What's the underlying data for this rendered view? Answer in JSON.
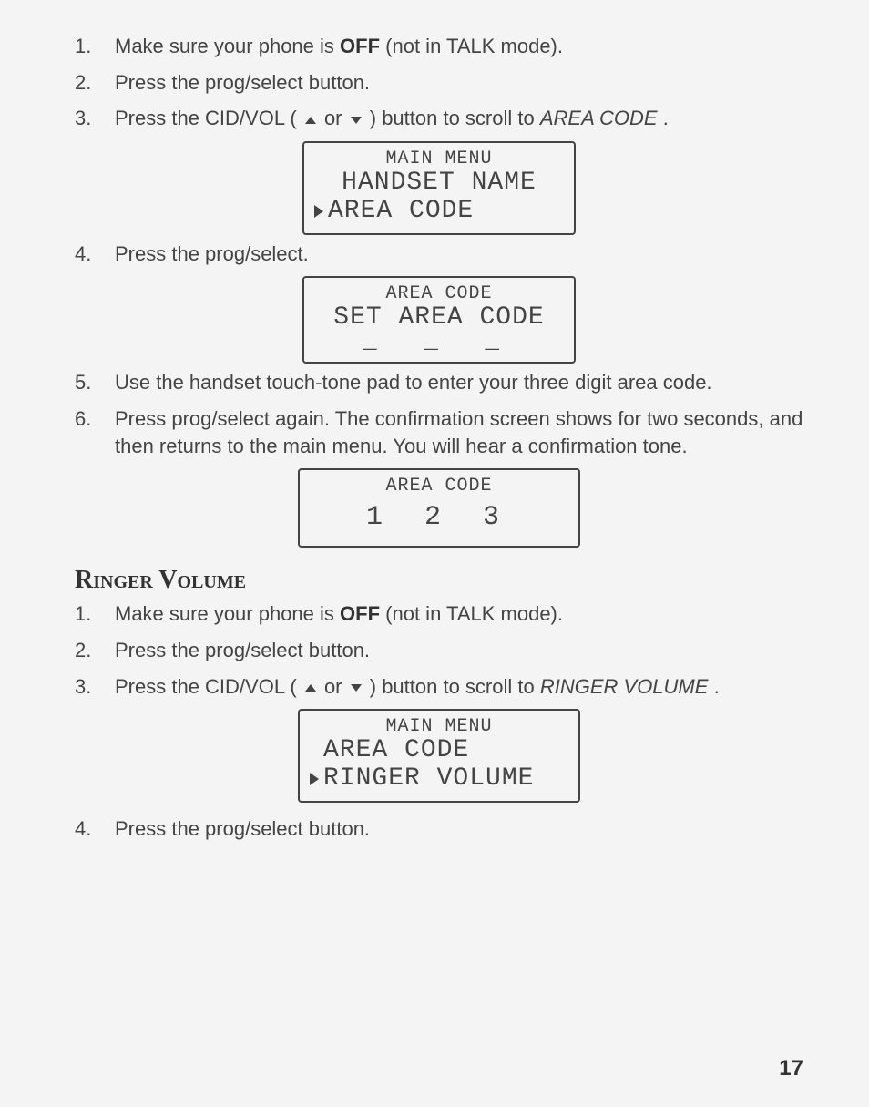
{
  "steps1": [
    {
      "n": "1.",
      "pre": "Make sure your phone is ",
      "bold": "OFF",
      "post": " (not in TALK mode)."
    },
    {
      "n": "2.",
      "text": "Press the prog/select button."
    },
    {
      "n": "3.",
      "pre": "Press the CID/VOL (",
      "arrows": true,
      "mid": " or ",
      "post": ") button to scroll to ",
      "ital": "AREA CODE",
      "tail": "."
    }
  ],
  "lcd1": {
    "title": "MAIN MENU",
    "line1": "HANDSET NAME",
    "line2": "AREA CODE"
  },
  "step4": {
    "n": "4.",
    "text": "Press the prog/select."
  },
  "lcd2": {
    "title": "AREA CODE",
    "line1": "SET AREA CODE",
    "under": "_ _ _"
  },
  "steps2": [
    {
      "n": "5.",
      "text": "Use the handset touch-tone pad to enter your three digit area code."
    },
    {
      "n": "6.",
      "text": "Press prog/select again. The confirmation screen shows for two seconds, and then returns to the main menu. You will hear a confirmation tone."
    }
  ],
  "lcd3": {
    "title": "AREA CODE",
    "digits": "1 2 3"
  },
  "section": "Ringer Volume",
  "steps3": [
    {
      "n": "1.",
      "pre": "Make sure your phone is ",
      "bold": "OFF",
      "post": " (not in TALK mode)."
    },
    {
      "n": "2.",
      "text": "Press the prog/select button."
    },
    {
      "n": "3.",
      "pre": "Press the CID/VOL (",
      "arrows": true,
      "mid": " or ",
      "post": ") button to scroll to ",
      "ital": "RINGER VOLUME",
      "tail": "."
    }
  ],
  "lcd4": {
    "title": "MAIN MENU",
    "line1": "AREA CODE",
    "line2": "RINGER VOLUME"
  },
  "step_last": {
    "n": "4.",
    "text": "Press the prog/select button."
  },
  "page": "17"
}
